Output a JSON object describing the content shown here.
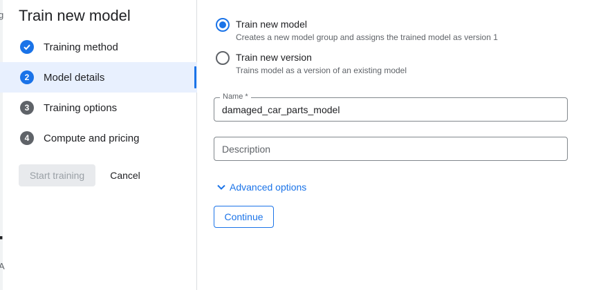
{
  "title": "Train new model",
  "background": {
    "glyph_top": "g",
    "glyph_mid": "e",
    "glyph_bottom": "A"
  },
  "steps": [
    {
      "number": "",
      "label": "Training method",
      "state": "done",
      "icon": "check-circle-icon"
    },
    {
      "number": "2",
      "label": "Model details",
      "state": "current",
      "icon": "step-number-icon"
    },
    {
      "number": "3",
      "label": "Training options",
      "state": "pending",
      "icon": "step-number-icon"
    },
    {
      "number": "4",
      "label": "Compute and pricing",
      "state": "pending",
      "icon": "step-number-icon"
    }
  ],
  "actions": {
    "start_label": "Start training",
    "cancel_label": "Cancel"
  },
  "options": [
    {
      "label": "Train new model",
      "description": "Creates a new model group and assigns the trained model as version 1",
      "selected": true
    },
    {
      "label": "Train new version",
      "description": "Trains model as a version of an existing model",
      "selected": false
    }
  ],
  "name_field": {
    "label": "Name *",
    "value": "damaged_car_parts_model"
  },
  "description_field": {
    "placeholder": "Description",
    "value": ""
  },
  "advanced_label": "Advanced options",
  "continue_label": "Continue",
  "colors": {
    "accent": "#1a73e8",
    "active_bg": "#e8f0fe",
    "disabled_bg": "#e8eaed"
  }
}
